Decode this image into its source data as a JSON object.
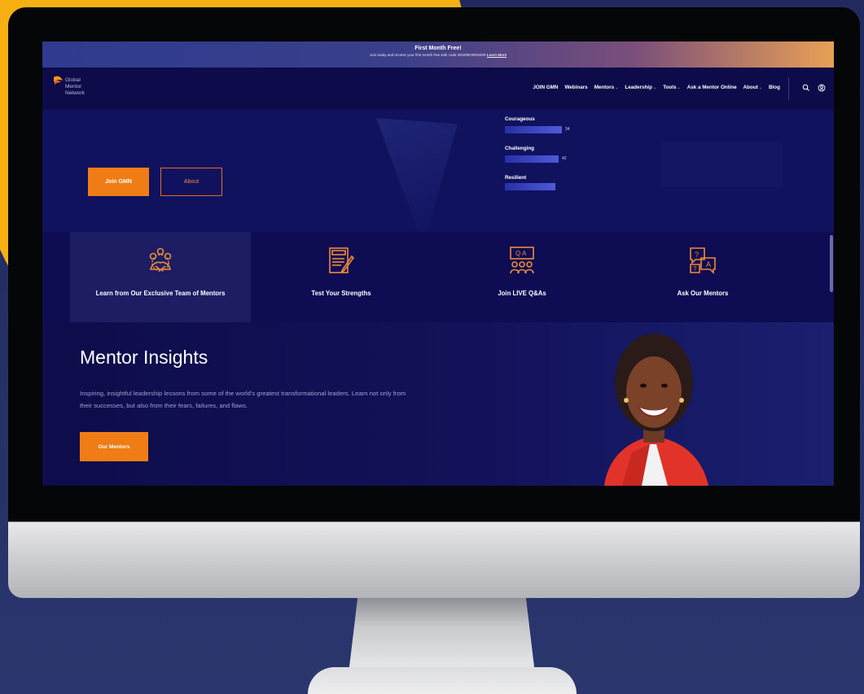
{
  "promo": {
    "title": "First Month Free!",
    "subtitle": "Join today and receive your first month free with code NOWMOREMOR",
    "link": "Learn More"
  },
  "logo": {
    "text": "Global\nMentor\nNetwork"
  },
  "nav": {
    "items": [
      {
        "label": "JOIN GMN",
        "dropdown": false
      },
      {
        "label": "Webinars",
        "dropdown": false
      },
      {
        "label": "Mentors",
        "dropdown": true
      },
      {
        "label": "Leadership",
        "dropdown": true
      },
      {
        "label": "Tools",
        "dropdown": true
      },
      {
        "label": "Ask a Mentor Online",
        "dropdown": false
      },
      {
        "label": "About",
        "dropdown": true
      },
      {
        "label": "Blog",
        "dropdown": false
      }
    ],
    "search_icon": "search-icon",
    "account_icon": "user-icon"
  },
  "hero": {
    "join_label": "Join GMN",
    "about_label": "About",
    "traits": [
      {
        "label": "Courageous",
        "value": "34",
        "fill": 0.78
      },
      {
        "label": "Challenging",
        "value": "42",
        "fill": 0.73
      },
      {
        "label": "Resilient",
        "value": "",
        "fill": 0.52
      }
    ]
  },
  "features": [
    {
      "label": "Learn from Our Exclusive Team of Mentors",
      "icon": "team-icon",
      "active": true
    },
    {
      "label": "Test Your Strengths",
      "icon": "test-icon",
      "active": false
    },
    {
      "label": "Join LIVE Q&As",
      "icon": "qa-icon",
      "active": false
    },
    {
      "label": "Ask Our Mentors",
      "icon": "question-chat-icon",
      "active": false
    }
  ],
  "insights": {
    "title": "Mentor Insights",
    "body": "Inspiring, insightful leadership lessons from some of the world's greatest transformational leaders. Learn not only from their successes, but also from their fears, failures, and flaws.",
    "button_label": "Our Mentors"
  },
  "colors": {
    "accent": "#f07c15",
    "navy": "#0d0b4a",
    "background_yellow": "#f6b012"
  }
}
